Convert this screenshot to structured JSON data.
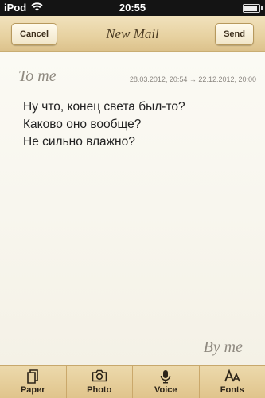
{
  "status_bar": {
    "carrier": "iPod",
    "time": "20:55",
    "battery_level": 0.9
  },
  "nav": {
    "cancel_label": "Cancel",
    "title": "New Mail",
    "send_label": "Send"
  },
  "mail": {
    "to_label": "To me",
    "dates": "28.03.2012, 20:54  → 22.12.2012, 20:00",
    "lines": [
      "Ну что, конец света был-то?",
      "Каково оно вообще?",
      "Не сильно влажно?"
    ],
    "by_label": "By me"
  },
  "toolbar": {
    "items": [
      {
        "label": "Paper",
        "icon": "paper-icon"
      },
      {
        "label": "Photo",
        "icon": "camera-icon"
      },
      {
        "label": "Voice",
        "icon": "microphone-icon"
      },
      {
        "label": "Fonts",
        "icon": "fonts-icon"
      }
    ]
  }
}
